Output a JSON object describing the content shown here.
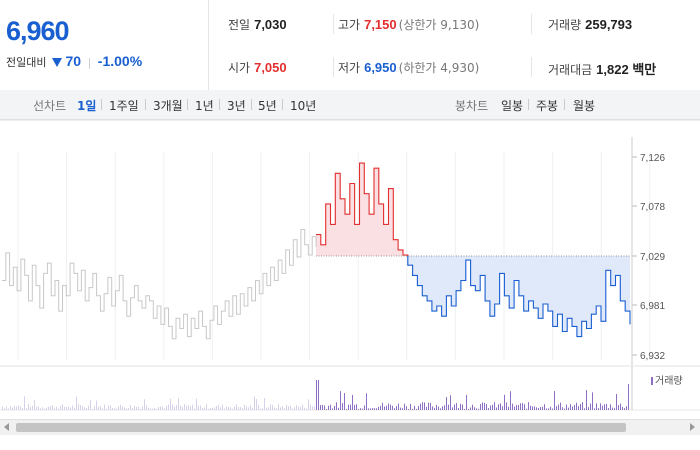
{
  "stock": {
    "price": "6,960",
    "change_label": "전일대비",
    "change_value": "70",
    "change_rate": "-1.00%"
  },
  "stats": {
    "prev_close": {
      "label": "전일",
      "value": "7,030"
    },
    "high": {
      "label": "고가",
      "value": "7,150",
      "limit": "(상한가 9,130)"
    },
    "volume": {
      "label": "거래량",
      "value": "259,793"
    },
    "open": {
      "label": "시가",
      "value": "7,050"
    },
    "low": {
      "label": "저가",
      "value": "6,950",
      "limit": "(하한가 4,930)"
    },
    "amount": {
      "label": "거래대금",
      "value": "1,822 백만"
    }
  },
  "toolbar": {
    "line_label": "선차트",
    "periods": [
      "1일",
      "1주일",
      "3개월",
      "1년",
      "3년",
      "5년",
      "10년"
    ],
    "candle_label": "봉차트",
    "candles": [
      "일봉",
      "주봉",
      "월봉"
    ]
  },
  "colors": {
    "up": "#e22e2e",
    "down": "#1a5fd1",
    "prev_day_line": "#c8c8c8",
    "volume": "#8f6fc4"
  },
  "chart_data": {
    "type": "line",
    "yticks": [
      "7,126",
      "7,078",
      "7,029",
      "6,981",
      "6,932"
    ],
    "ylim": [
      6932,
      7126
    ],
    "baseline": 7029,
    "volume_legend": "거래량",
    "prev_day_series": [
      7005,
      7032,
      7000,
      7018,
      6995,
      7026,
      7010,
      6985,
      7020,
      7000,
      6978,
      7012,
      7022,
      6990,
      7005,
      6975,
      7000,
      6990,
      7022,
      7012,
      6995,
      7015,
      6985,
      6998,
      7012,
      6990,
      6975,
      6992,
      7008,
      6980,
      6995,
      7010,
      6985,
      6970,
      6988,
      7000,
      6985,
      6978,
      6990,
      6985,
      6968,
      6980,
      6962,
      6978,
      6960,
      6948,
      6968,
      6958,
      6972,
      6950,
      6968,
      6958,
      6975,
      6960,
      6948,
      6966,
      6980,
      6962,
      6975,
      6985,
      6970,
      6990,
      6972,
      6992,
      6980,
      6998,
      6985,
      7005,
      6992,
      7012,
      7000,
      7018,
      7005,
      7025,
      7012,
      7035,
      7020,
      7045,
      7028,
      7055,
      7040,
      7030,
      7048,
      7038
    ],
    "today_series": [
      7050,
      7040,
      7080,
      7060,
      7110,
      7085,
      7070,
      7100,
      7060,
      7120,
      7090,
      7070,
      7115,
      7080,
      7060,
      7095,
      7045,
      7035,
      7030,
      7020,
      7010,
      7000,
      6990,
      6985,
      6975,
      6980,
      6970,
      6990,
      6980,
      6995,
      7005,
      7025,
      7000,
      6995,
      7010,
      6985,
      6970,
      6982,
      7012,
      6990,
      6978,
      7005,
      6990,
      6975,
      6985,
      6978,
      6968,
      6982,
      6975,
      6960,
      6972,
      6955,
      6968,
      6960,
      6950,
      6965,
      6958,
      6972,
      6980,
      6965,
      7015,
      7000,
      7010,
      6985,
      6975,
      6962
    ]
  }
}
